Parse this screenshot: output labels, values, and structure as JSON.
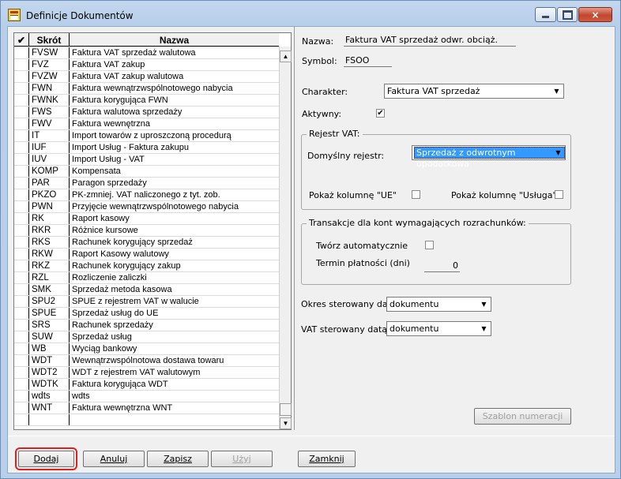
{
  "window": {
    "title": "Definicje Dokumentów",
    "close_glyph": "×"
  },
  "grid": {
    "check_header": "✔",
    "col_skrot": "Skrót",
    "col_nazwa": "Nazwa",
    "rows": [
      {
        "skrot": "FVSW",
        "nazwa": "Faktura VAT sprzedaż walutowa"
      },
      {
        "skrot": "FVZ",
        "nazwa": "Faktura VAT zakup"
      },
      {
        "skrot": "FVZW",
        "nazwa": "Faktura VAT zakup walutowa"
      },
      {
        "skrot": "FWN",
        "nazwa": "Faktura wewnątrzwspólnotowego nabycia"
      },
      {
        "skrot": "FWNK",
        "nazwa": "Faktura korygująca FWN"
      },
      {
        "skrot": "FWS",
        "nazwa": "Faktura walutowa sprzedaży"
      },
      {
        "skrot": "FWV",
        "nazwa": "Faktura wewnętrzna"
      },
      {
        "skrot": "IT",
        "nazwa": "Import towarów z uproszczoną procedurą"
      },
      {
        "skrot": "IUF",
        "nazwa": "Import Usług - Faktura zakupu"
      },
      {
        "skrot": "IUV",
        "nazwa": "Import Usług - VAT"
      },
      {
        "skrot": "KOMP",
        "nazwa": "Kompensata"
      },
      {
        "skrot": "PAR",
        "nazwa": "Paragon sprzedaży"
      },
      {
        "skrot": "PKZO",
        "nazwa": "PK-zmniej. VAT naliczonego z tyt. zob."
      },
      {
        "skrot": "PWN",
        "nazwa": "Przyjęcie wewnątrzwspólnotowego nabycia"
      },
      {
        "skrot": "RK",
        "nazwa": "Raport kasowy"
      },
      {
        "skrot": "RKR",
        "nazwa": "Różnice kursowe"
      },
      {
        "skrot": "RKS",
        "nazwa": "Rachunek korygujący sprzedaż"
      },
      {
        "skrot": "RKW",
        "nazwa": "Raport Kasowy walutowy"
      },
      {
        "skrot": "RKZ",
        "nazwa": "Rachunek korygujący zakup"
      },
      {
        "skrot": "RZL",
        "nazwa": "Rozliczenie zaliczki"
      },
      {
        "skrot": "SMK",
        "nazwa": "Sprzedaż metoda kasowa"
      },
      {
        "skrot": "SPU2",
        "nazwa": "SPUE z rejestrem VAT w walucie"
      },
      {
        "skrot": "SPUE",
        "nazwa": "Sprzedaż usług do UE"
      },
      {
        "skrot": "SRS",
        "nazwa": "Rachunek sprzedaży"
      },
      {
        "skrot": "SUW",
        "nazwa": "Sprzedaż usług"
      },
      {
        "skrot": "WB",
        "nazwa": "Wyciąg bankowy"
      },
      {
        "skrot": "WDT",
        "nazwa": "Wewnątrzwspólnotowa dostawa towaru"
      },
      {
        "skrot": "WDT2",
        "nazwa": "WDT z rejestrem VAT walutowym"
      },
      {
        "skrot": "WDTK",
        "nazwa": "Faktura korygująca WDT"
      },
      {
        "skrot": "wdts",
        "nazwa": "wdts"
      },
      {
        "skrot": "WNT",
        "nazwa": "Faktura wewnętrzna WNT"
      },
      {
        "skrot": "",
        "nazwa": ""
      }
    ]
  },
  "form": {
    "nazwa_label": "Nazwa:",
    "nazwa_value": "Faktura VAT sprzedaż odwr. obciąż.",
    "symbol_label": "Symbol:",
    "symbol_value": "FSOO",
    "charakter_label": "Charakter:",
    "charakter_value": "Faktura VAT sprzedaż",
    "aktywny_label": "Aktywny:",
    "aktywny_checked": "✔",
    "rejestr_group": "Rejestr VAT:",
    "domyslny_label": "Domyślny rejestr:",
    "domyslny_value": "Sprzedaż z odwrotnym opodatkowa",
    "pokaz_ue_label": "Pokaż kolumnę \"UE\"",
    "pokaz_usluga_label": "Pokaż kolumnę \"Usługa\"",
    "transakcje_group": "Transakcje dla kont wymagających rozrachunków:",
    "tworz_label": "Twórz automatycznie",
    "termin_label": "Termin płatności (dni)",
    "termin_value": "0",
    "okres_label": "Okres sterowany datą:",
    "okres_value": "dokumentu",
    "vat_label": "VAT sterowany datą:",
    "vat_value": "dokumentu",
    "szablon_label": "Szablon numeracji"
  },
  "buttons": {
    "dodaj": "Dodaj",
    "anuluj": "Anuluj",
    "zapisz": "Zapisz",
    "uzyj": "Użyj",
    "zamknij": "Zamknij"
  },
  "icons": {
    "app": "document-definitions-icon",
    "dropdown": "▼",
    "scroll_up": "▲",
    "scroll_down": "▼"
  }
}
